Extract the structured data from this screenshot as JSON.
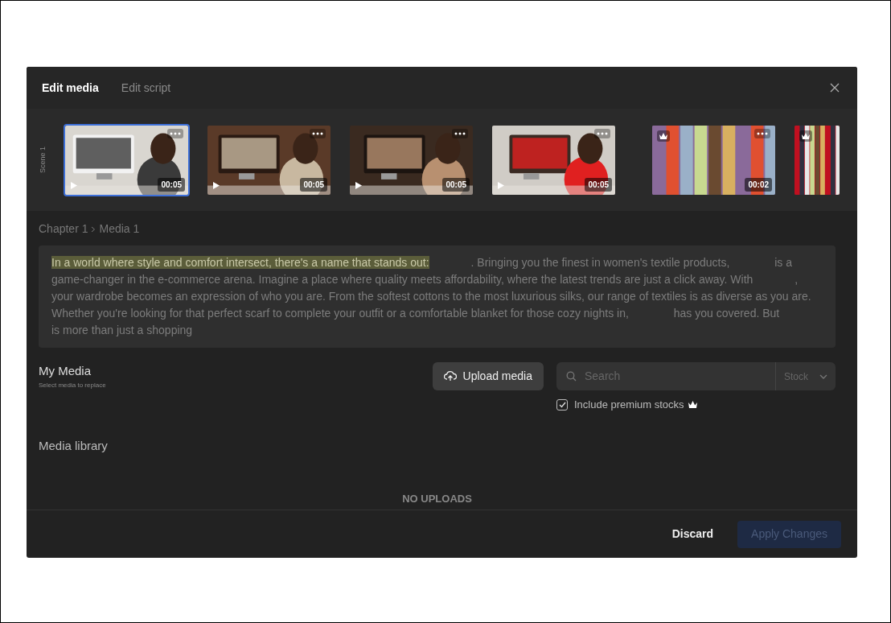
{
  "tabs": [
    {
      "label": "Edit media",
      "selected": true
    },
    {
      "label": "Edit script",
      "selected": false
    }
  ],
  "scene": {
    "label": "Scene 1"
  },
  "thumbnails": [
    {
      "kind": "video",
      "selected": true,
      "duration": "00:05"
    },
    {
      "kind": "video",
      "selected": false,
      "duration": "00:05"
    },
    {
      "kind": "video",
      "selected": false,
      "duration": "00:05"
    },
    {
      "kind": "video",
      "selected": false,
      "duration": "00:05"
    },
    {
      "kind": "premium",
      "selected": false,
      "duration": "00:02"
    },
    {
      "kind": "premium",
      "selected": false
    }
  ],
  "breadcrumb": [
    "Chapter 1",
    "Media 1"
  ],
  "script": {
    "highlight": "In a world where style and comfort intersect, there's a name that stands out:",
    "segments": [
      ". Bringing you the finest in women's textile products,",
      "is a game-changer in the e-commerce arena. Imagine a place where quality meets affordability, where the latest trends are just a click away. With",
      ", your wardrobe becomes an expression of who you are. From the softest cottons to the most luxurious silks, our range of textiles is as diverse as you are. Whether you're looking for that perfect scarf to complete your outfit or a comfortable blanket for those cozy nights in,",
      "has you covered. But",
      "is more than just a shopping"
    ]
  },
  "my_media": {
    "title": "My Media",
    "subtitle": "Select media to replace",
    "upload_label": "Upload media",
    "search_placeholder": "Search",
    "source": "Stock",
    "premium_label": "Include premium stocks",
    "premium_checked": true
  },
  "library": {
    "title": "Media library",
    "empty": "NO UPLOADS"
  },
  "footer": {
    "discard": "Discard",
    "apply": "Apply Changes",
    "apply_disabled": true
  }
}
